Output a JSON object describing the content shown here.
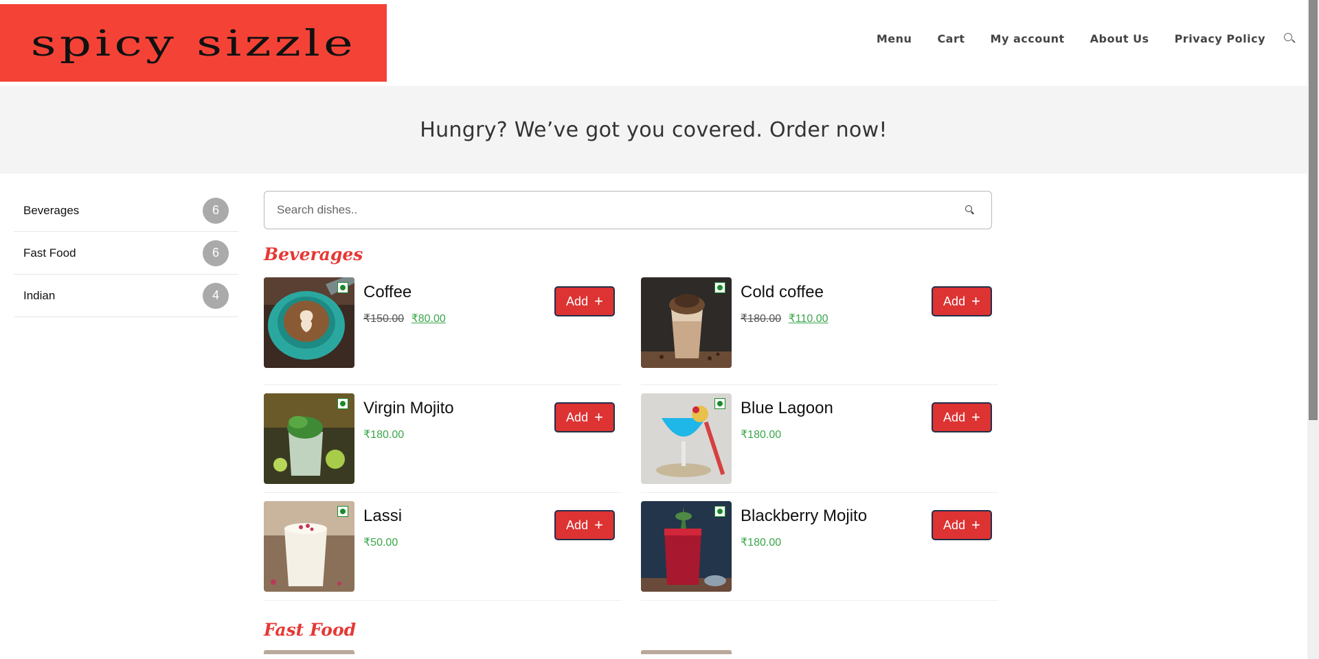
{
  "header": {
    "logo_text": "spicy sizzle",
    "nav": [
      "Menu",
      "Cart",
      "My account",
      "About Us",
      "Privacy Policy"
    ]
  },
  "hero": {
    "text": "Hungry? We’ve got you covered. Order now!"
  },
  "sidebar": {
    "categories": [
      {
        "label": "Beverages",
        "count": "6"
      },
      {
        "label": "Fast Food",
        "count": "6"
      },
      {
        "label": "Indian",
        "count": "4"
      }
    ]
  },
  "search": {
    "placeholder": "Search dishes.."
  },
  "sections": [
    {
      "title": "Beverages",
      "dishes": [
        {
          "name": "Coffee",
          "old_price": "₹150.00",
          "price": "₹80.00",
          "button": "Add"
        },
        {
          "name": "Cold coffee",
          "old_price": "₹180.00",
          "price": "₹110.00",
          "button": "Add"
        },
        {
          "name": "Virgin Mojito",
          "old_price": "",
          "price": "₹180.00",
          "button": "Add"
        },
        {
          "name": "Blue Lagoon",
          "old_price": "",
          "price": "₹180.00",
          "button": "Add"
        },
        {
          "name": "Lassi",
          "old_price": "",
          "price": "₹50.00",
          "button": "Add"
        },
        {
          "name": "Blackberry Mojito",
          "old_price": "",
          "price": "₹180.00",
          "button": "Add"
        }
      ]
    },
    {
      "title": "Fast Food"
    }
  ],
  "colors": {
    "brand": "#f44336",
    "accent": "#e53935",
    "price": "#3aa64a",
    "button": "#dd3333"
  },
  "icons": {
    "nav_search": "search-icon",
    "field_search": "search-icon",
    "veg": "veg-indicator-icon",
    "add": "plus-icon"
  }
}
